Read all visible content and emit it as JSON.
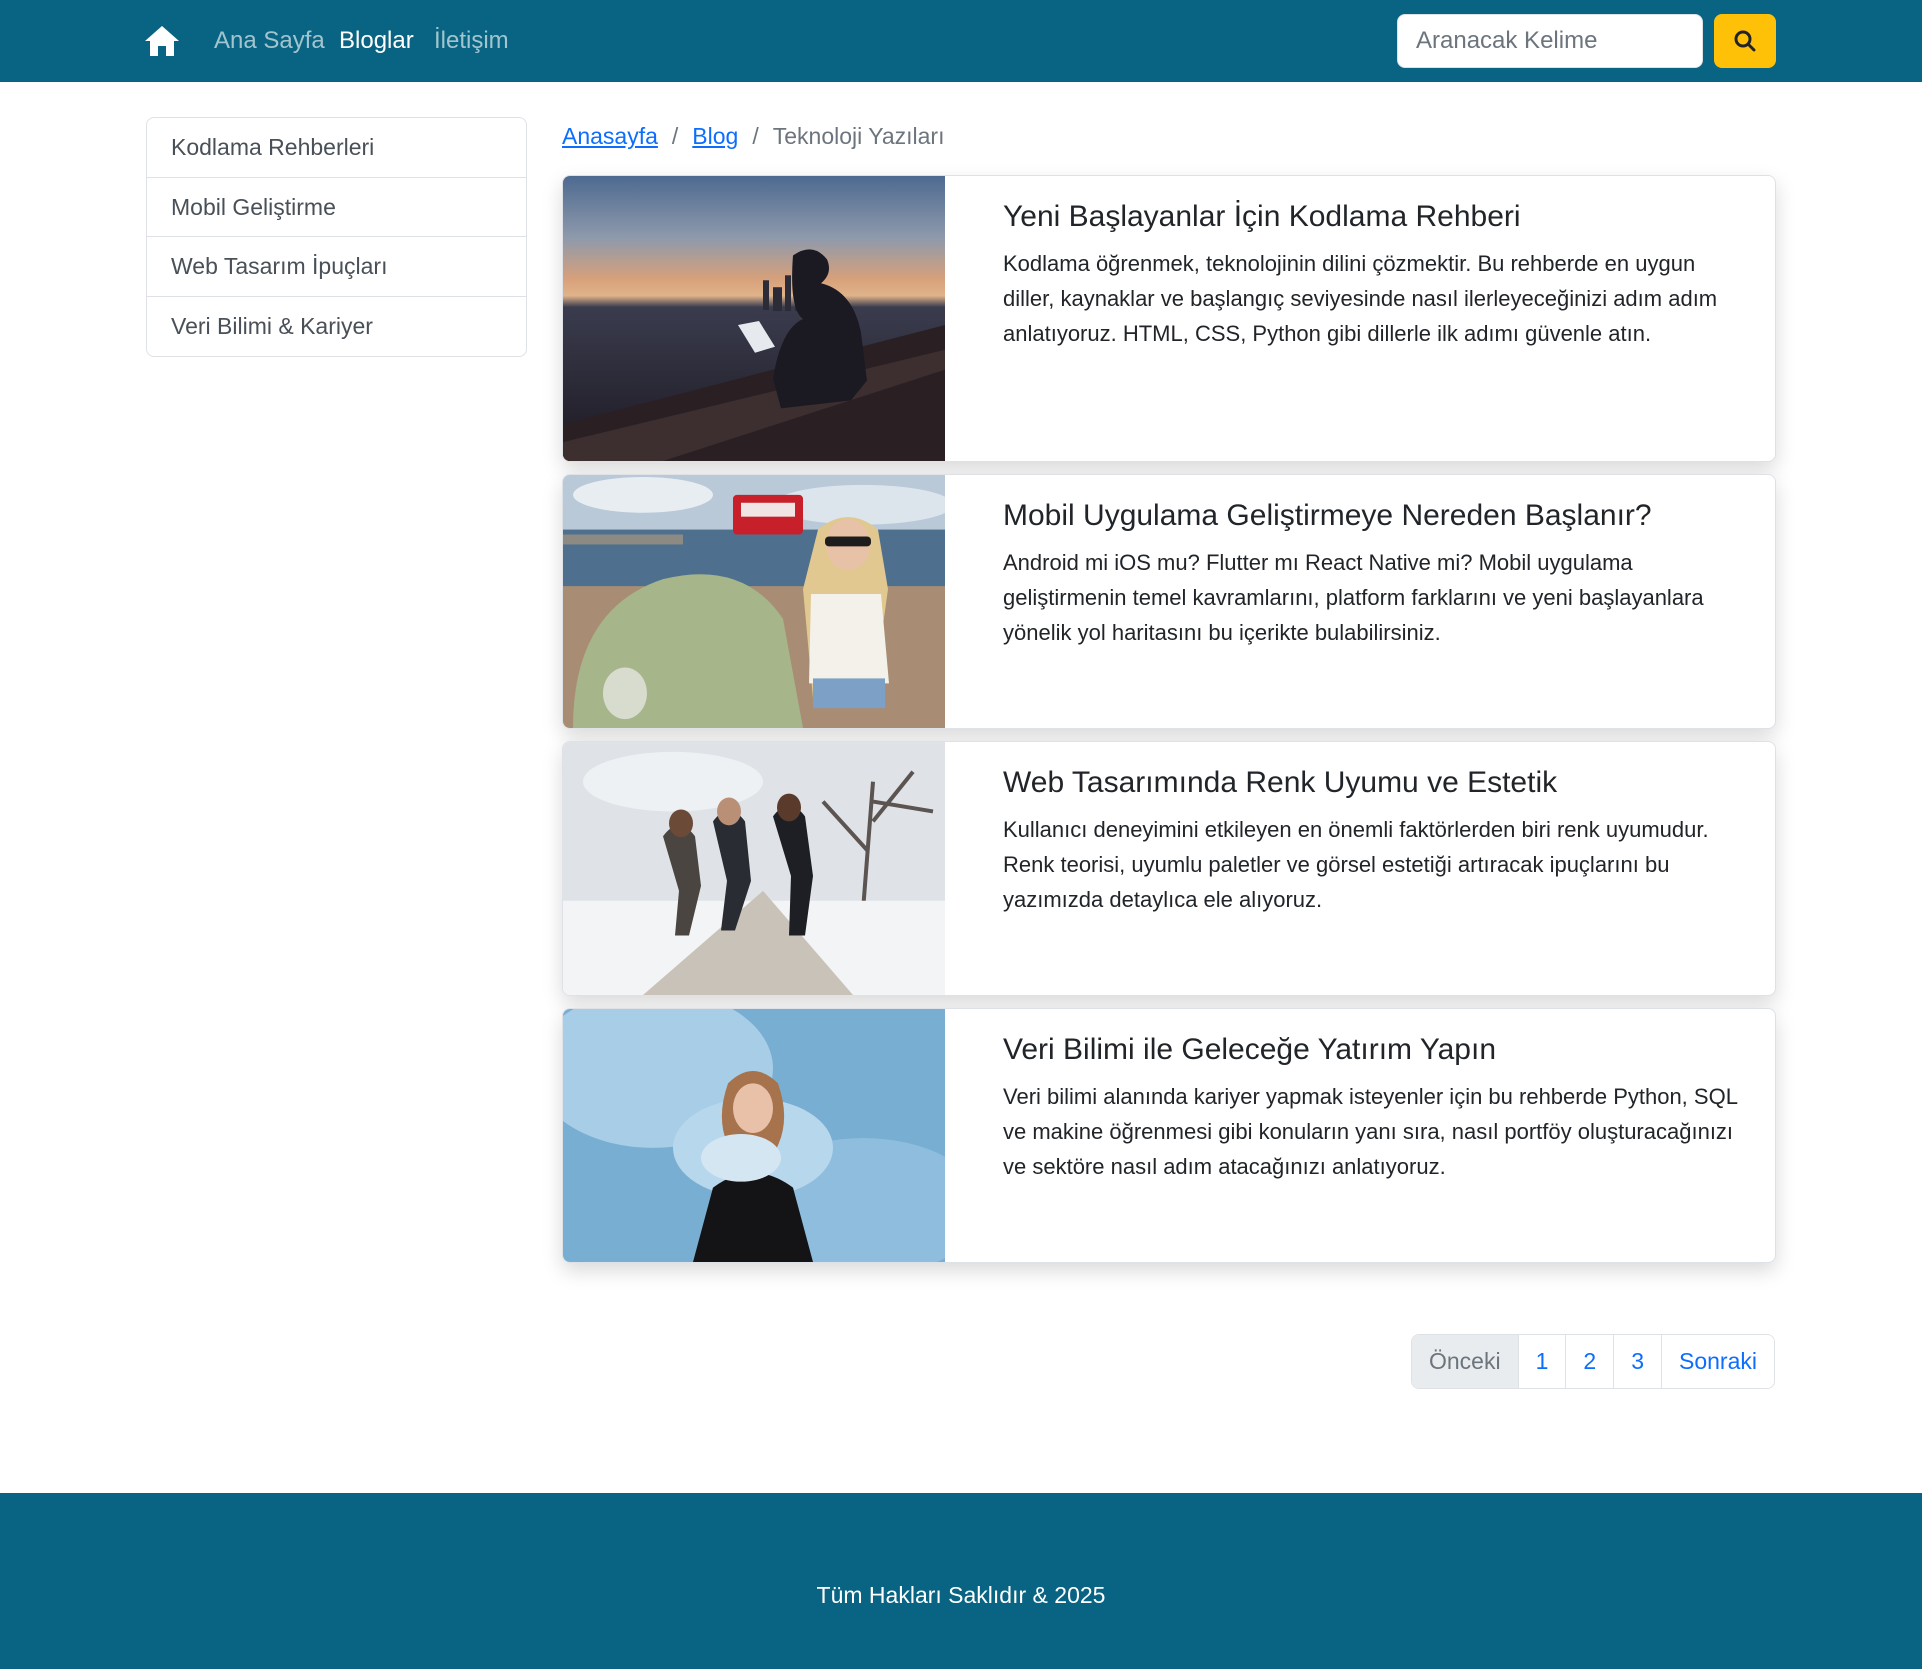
{
  "navbar": {
    "home_icon": "home-icon",
    "links": [
      "Ana Sayfa",
      "Bloglar",
      "İletişim"
    ],
    "active": "Bloglar",
    "search": {
      "placeholder": "Aranacak Kelime",
      "value": "",
      "button_icon": "search-icon"
    }
  },
  "sidebar": {
    "items": [
      "Kodlama Rehberleri",
      "Mobil Geliştirme",
      "Web Tasarım İpuçları",
      "Veri Bilimi & Kariyer"
    ]
  },
  "breadcrumb": {
    "items": [
      "Anasayfa",
      "Blog",
      "Teknoloji Yazıları"
    ],
    "separator": "/"
  },
  "posts": [
    {
      "title": "Yeni Başlayanlar İçin Kodlama Rehberi",
      "text": "Kodlama öğrenmek, teknolojinin dilini çözmektir. Bu rehberde en uygun diller, kaynaklar ve başlangıç seviyesinde nasıl ilerleyeceğinizi adım adım anlatıyoruz. HTML, CSS, Python gibi dillerle ilk adımı güvenle atın.",
      "image": "person-laptop-city-sunset-photo"
    },
    {
      "title": "Mobil Uygulama Geliştirmeye Nereden Başlanır?",
      "text": "Android mi iOS mu? Flutter mı React Native mi? Mobil uygulama geliştirmenin temel kavramlarını, platform farklarını ve yeni başlayanlara yönelik yol haritasını bu içerikte bulabilirsiniz.",
      "image": "woman-vintage-car-beach-photo"
    },
    {
      "title": "Web Tasarımında Renk Uyumu ve Estetik",
      "text": "Kullanıcı deneyimini etkileyen en önemli faktörlerden biri renk uyumudur. Renk teorisi, uyumlu paletler ve görsel estetiği artıracak ipuçlarını bu yazımızda detaylıca ele alıyoruz.",
      "image": "friends-jumping-snow-photo"
    },
    {
      "title": "Veri Bilimi ile Geleceğe Yatırım Yapın",
      "text": "Veri bilimi alanında kariyer yapmak isteyenler için bu rehberde Python, SQL ve makine öğrenmesi gibi konuların yanı sıra, nasıl portföy oluşturacağınızı ve sektöre nasıl adım atacağınızı anlatıyoruz.",
      "image": "woman-blue-smoke-photo"
    }
  ],
  "pagination": {
    "prev": "Önceki",
    "pages": [
      "1",
      "2",
      "3"
    ],
    "next": "Sonraki",
    "prev_disabled": true
  },
  "footer": {
    "text": "Tüm Hakları Saklıdır & 2025"
  },
  "colors": {
    "navbar": "#086482",
    "search_button": "#ffc107",
    "link": "#0d6efd",
    "footer": "#086482"
  }
}
